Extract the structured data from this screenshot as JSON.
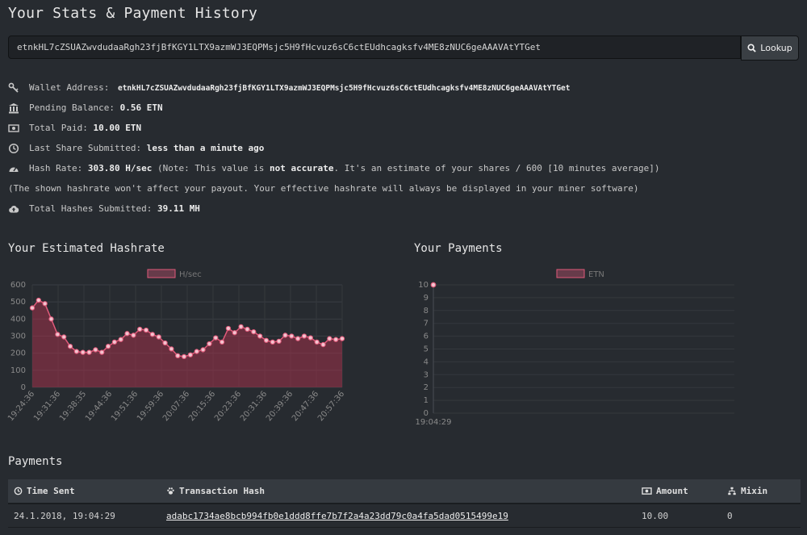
{
  "page": {
    "title": "Your Stats & Payment History"
  },
  "lookup": {
    "address_value": "etnkHL7cZSUAZwvdudaaRgh23fjBfKGY1LTX9azmWJ3EQPMsjc5H9fHcvuz6sC6ctEUdhcagksfv4ME8zNUC6geAAAVAtYTGet",
    "button_label": "Lookup",
    "button_icon": "search-icon"
  },
  "stats": {
    "wallet_label": "Wallet Address:",
    "wallet_value": "etnkHL7cZSUAZwvdudaaRgh23fjBfKGY1LTX9azmWJ3EQPMsjc5H9fHcvuz6sC6ctEUdhcagksfv4ME8zNUC6geAAAVAtYTGet",
    "pending_label": "Pending Balance:",
    "pending_value": "0.56 ETN",
    "total_paid_label": "Total Paid:",
    "total_paid_value": "10.00 ETN",
    "last_share_label": "Last Share Submitted:",
    "last_share_value": "less than a minute ago",
    "hashrate_label": "Hash Rate:",
    "hashrate_value": "303.80 H/sec",
    "hashrate_note_pre": "(Note: This value is",
    "hashrate_note_bold": "not accurate",
    "hashrate_note_post": ". It's an estimate of your shares / 600 [10 minutes average])",
    "hashrate_disclaimer": "(The shown hashrate won't affect your payout. Your effective hashrate will always be displayed in your miner software)",
    "total_hashes_label": "Total Hashes Submitted:",
    "total_hashes_value": "39.11 MH"
  },
  "sections": {
    "hashrate_title": "Your Estimated Hashrate",
    "payments_chart_title": "Your Payments",
    "payments_table_title": "Payments"
  },
  "chart_data": [
    {
      "type": "area",
      "legend": "H/sec",
      "color": "#e05a7a",
      "ylim": [
        0,
        600
      ],
      "yticks": [
        0,
        100,
        200,
        300,
        400,
        500,
        600
      ],
      "xtick_labels": [
        "19:24:36",
        "19:31:36",
        "19:38:35",
        "19:44:36",
        "19:51:36",
        "19:59:36",
        "20:07:36",
        "20:15:36",
        "20:23:36",
        "20:31:36",
        "20:39:36",
        "20:47:36",
        "20:57:36"
      ],
      "values": [
        465,
        510,
        490,
        400,
        310,
        295,
        240,
        210,
        205,
        205,
        220,
        205,
        240,
        265,
        280,
        315,
        305,
        340,
        335,
        310,
        295,
        260,
        225,
        185,
        180,
        190,
        210,
        220,
        255,
        290,
        265,
        345,
        320,
        355,
        340,
        325,
        300,
        275,
        265,
        270,
        305,
        300,
        285,
        300,
        290,
        265,
        250,
        285,
        280,
        285
      ]
    },
    {
      "type": "scatter",
      "legend": "ETN",
      "color": "#e05a7a",
      "ylim": [
        0,
        10
      ],
      "yticks": [
        0,
        1,
        2,
        3,
        4,
        5,
        6,
        7,
        8,
        9,
        10
      ],
      "xtick_labels": [
        "19:04:29"
      ],
      "points": [
        {
          "x": "19:04:29",
          "y": 10
        }
      ]
    }
  ],
  "payments_table": {
    "headers": {
      "time": "Time Sent",
      "hash": "Transaction Hash",
      "amount": "Amount",
      "mixin": "Mixin"
    },
    "rows": [
      {
        "time": "24.1.2018, 19:04:29",
        "hash": "adabc1734ae8bcb994fb0e1ddd8ffe7b7f2a4a23dd79c0a4fa5dad0515499e19",
        "amount": "10.00",
        "mixin": "0"
      }
    ]
  }
}
